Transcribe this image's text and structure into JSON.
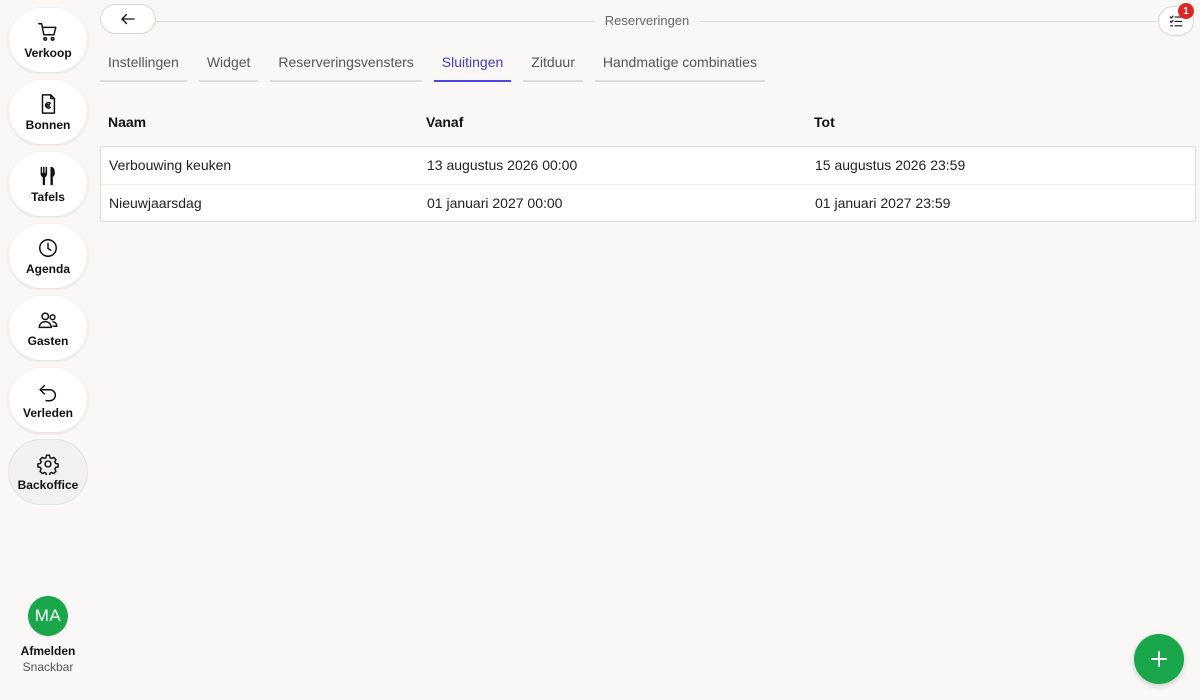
{
  "sidebar": {
    "items": [
      {
        "label": "Verkoop",
        "icon": "cart-icon"
      },
      {
        "label": "Bonnen",
        "icon": "receipt-euro-icon"
      },
      {
        "label": "Tafels",
        "icon": "cutlery-icon"
      },
      {
        "label": "Agenda",
        "icon": "clock-icon"
      },
      {
        "label": "Gasten",
        "icon": "users-icon"
      },
      {
        "label": "Verleden",
        "icon": "undo-icon"
      },
      {
        "label": "Backoffice",
        "icon": "gear-icon",
        "active": true
      }
    ],
    "profile": {
      "initials": "MA",
      "logout_label": "Afmelden",
      "venue": "Snackbar",
      "avatar_color": "#1aa64a"
    }
  },
  "header": {
    "title": "Reserveringen",
    "back_icon": "arrow-left-icon",
    "checklist_icon": "checklist-icon",
    "notification_count": "1"
  },
  "tabs": [
    {
      "label": "Instellingen"
    },
    {
      "label": "Widget"
    },
    {
      "label": "Reserveringsvensters"
    },
    {
      "label": "Sluitingen",
      "active": true
    },
    {
      "label": "Zitduur"
    },
    {
      "label": "Handmatige combinaties"
    }
  ],
  "table": {
    "columns": [
      "Naam",
      "Vanaf",
      "Tot"
    ],
    "rows": [
      [
        "Verbouwing keuken",
        "13 augustus 2026 00:00",
        "15 augustus 2026 23:59"
      ],
      [
        "Nieuwjaarsdag",
        "01 januari 2027 00:00",
        "01 januari 2027 23:59"
      ]
    ]
  },
  "fab": {
    "icon": "plus-icon",
    "color": "#1aa64a"
  },
  "colors": {
    "accent": "#4f46e5",
    "brand_green": "#1aa64a",
    "badge_red": "#e02424",
    "background": "#f9f8f6"
  }
}
